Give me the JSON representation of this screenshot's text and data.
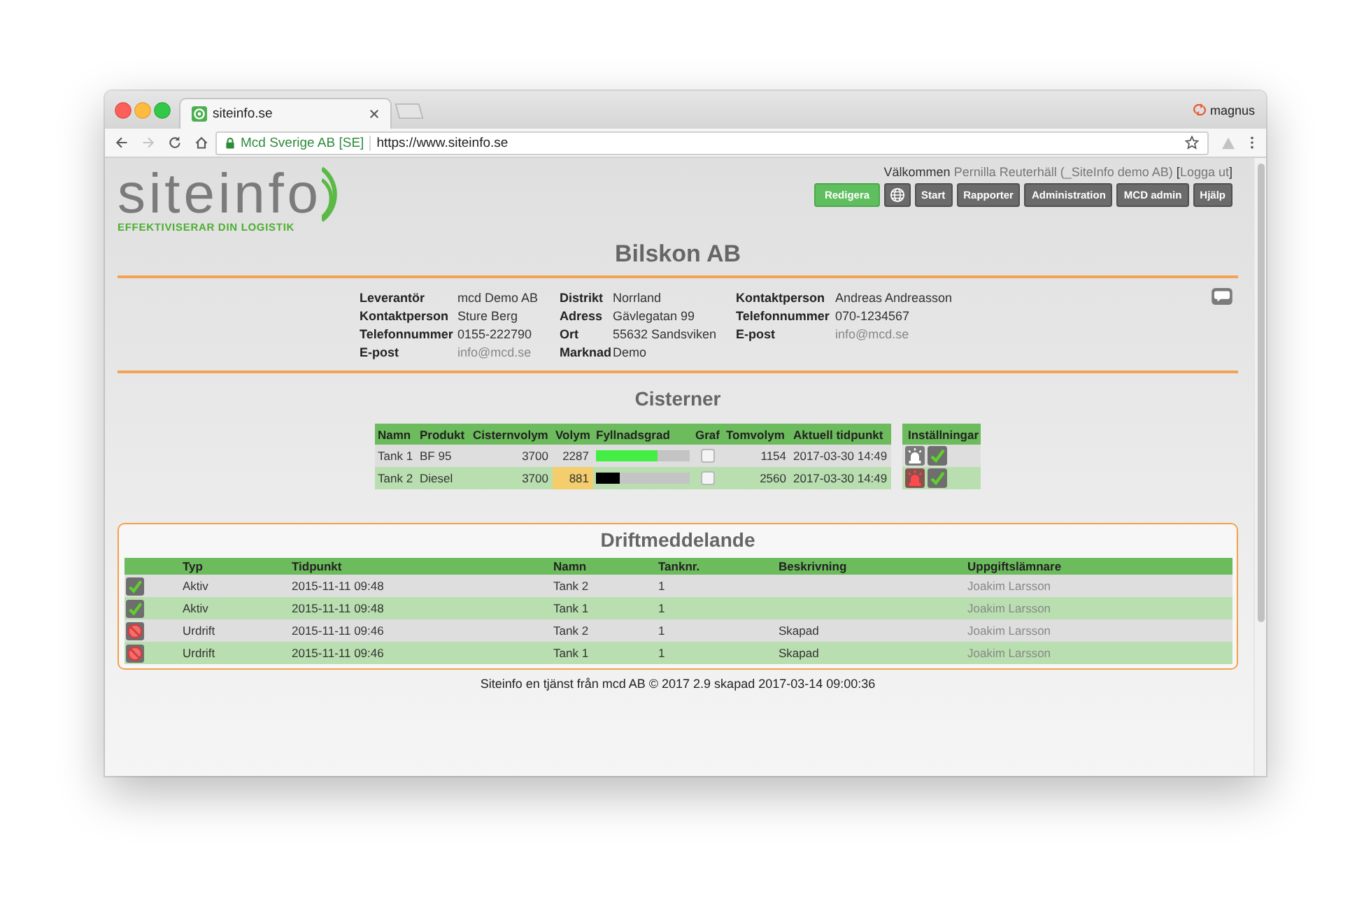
{
  "browser": {
    "tabs": [
      {
        "title": "siteinfo.se",
        "selected": true
      }
    ],
    "profile": "magnus",
    "forward_disabled": true,
    "site_identity": "Mcd Sverige AB [SE]",
    "url": "https://www.siteinfo.se"
  },
  "header": {
    "logo": "siteinfo",
    "tagline": "EFFEKTIVISERAR DIN LOGISTIK",
    "welcome": {
      "greeting": "Välkommen",
      "user": "Pernilla Reuterhäll (_SiteInfo demo AB)",
      "bracket_open": "[",
      "logout": "Logga ut",
      "bracket_close": "]"
    },
    "nav": [
      {
        "kind": "accent",
        "label": "Redigera"
      },
      {
        "kind": "globe"
      },
      {
        "kind": "plain",
        "label": "Start"
      },
      {
        "kind": "plain",
        "label": "Rapporter"
      },
      {
        "kind": "plain",
        "label": "Administration"
      },
      {
        "kind": "plain",
        "label": "MCD admin"
      },
      {
        "kind": "plain",
        "label": "Hjälp"
      }
    ]
  },
  "title": "Bilskon AB",
  "info": {
    "groups": [
      [
        {
          "kind": "text",
          "label": "Leverantör",
          "value": "mcd Demo AB"
        },
        {
          "kind": "text",
          "label": "Kontaktperson",
          "value": "Sture Berg"
        },
        {
          "kind": "text",
          "label": "Telefonnummer",
          "value": "0155-222790"
        },
        {
          "kind": "email",
          "label": "E-post",
          "value": "info@mcd.se"
        }
      ],
      [
        {
          "kind": "text",
          "label": "Distrikt",
          "value": "Norrland"
        },
        {
          "kind": "text",
          "label": "Adress",
          "value": "Gävlegatan 99"
        },
        {
          "kind": "text",
          "label": "Ort",
          "value": "55632 Sandsviken"
        },
        {
          "kind": "text",
          "label": "Marknad",
          "value": "Demo"
        }
      ],
      [
        {
          "kind": "text",
          "label": "Kontaktperson",
          "value": "Andreas Andreasson"
        },
        {
          "kind": "text",
          "label": "Telefonnummer",
          "value": "070-1234567"
        },
        {
          "kind": "email",
          "label": "E-post",
          "value": "info@mcd.se"
        }
      ]
    ]
  },
  "cisterns": {
    "title": "Cisterner",
    "columns": [
      "Namn",
      "Produkt",
      "Cisternvolym",
      "Volym",
      "Fyllnadsgrad",
      "Graf",
      "Tomvolym",
      "Aktuell tidpunkt"
    ],
    "settings_heading": "Inställningar",
    "rows": [
      {
        "name": "Tank 1",
        "product": "BF 95",
        "capacity": "3700",
        "volume": "2287",
        "low": false,
        "level": 0.66,
        "color": "#44ee44",
        "graph": false,
        "empty_volume": "1154",
        "updated": "2017-03-30 14:49",
        "alarm": false
      },
      {
        "name": "Tank 2",
        "product": "Diesel",
        "capacity": "3700",
        "volume": "881",
        "low": true,
        "level": 0.25,
        "color": "#000000",
        "graph": false,
        "empty_volume": "2560",
        "updated": "2017-03-30 14:49",
        "alarm": true
      }
    ]
  },
  "messages": {
    "title": "Driftmeddelande",
    "columns": [
      "Typ",
      "Tidpunkt",
      "Namn",
      "Tanknr.",
      "Beskrivning",
      "Uppgiftslämnare"
    ],
    "rows": [
      {
        "kind": "active",
        "type": "Aktiv",
        "time": "2015-11-11 09:48",
        "name": "Tank 2",
        "tank_no": "1",
        "reporter": "Joakim Larsson"
      },
      {
        "kind": "active",
        "type": "Aktiv",
        "time": "2015-11-11 09:48",
        "name": "Tank 1",
        "tank_no": "1",
        "reporter": "Joakim Larsson"
      },
      {
        "kind": "outage",
        "type": "Urdrift",
        "time": "2015-11-11 09:46",
        "name": "Tank 2",
        "tank_no": "1",
        "description": "Skapad",
        "reporter": "Joakim Larsson"
      },
      {
        "kind": "outage",
        "type": "Urdrift",
        "time": "2015-11-11 09:46",
        "name": "Tank 1",
        "tank_no": "1",
        "description": "Skapad",
        "reporter": "Joakim Larsson"
      }
    ]
  },
  "footer": "Siteinfo en tjänst från mcd AB © 2017 2.9 skapad 2017-03-14 09:00:36"
}
